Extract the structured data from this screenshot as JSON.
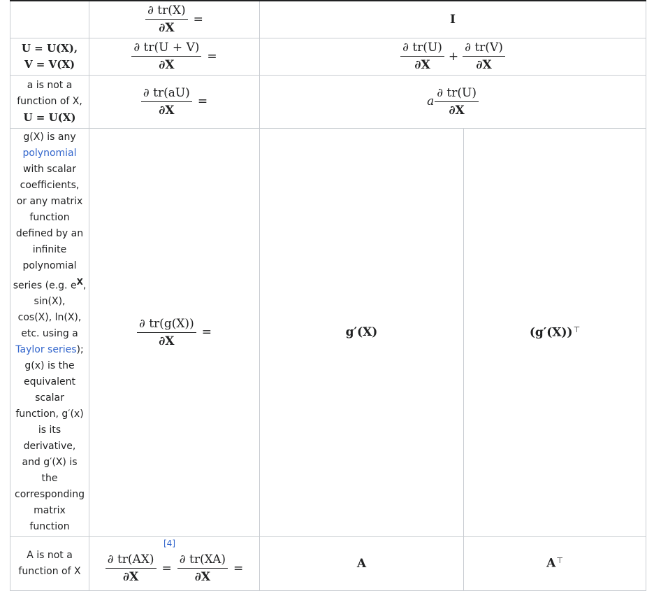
{
  "rows": {
    "r1": {
      "cond": "",
      "lhs_num": "∂ tr(X)",
      "eq": "=",
      "result": "I"
    },
    "r2": {
      "cond_line1": "U = U(X),",
      "cond_line2": "V = V(X)",
      "lhs_num": "∂ tr(U + V)",
      "lhs_den": "∂X",
      "eq": "=",
      "res_num1": "∂ tr(U)",
      "res_den1": "∂X",
      "plus": "+",
      "res_num2": "∂ tr(V)",
      "res_den2": "∂X"
    },
    "r3": {
      "cond_line1": "a is not a",
      "cond_line2": "function of X,",
      "cond_line3": "U = U(X)",
      "lhs_num": "∂ tr(aU)",
      "lhs_den": "∂X",
      "eq": "=",
      "res_coef": "a",
      "res_num": "∂ tr(U)",
      "res_den": "∂X"
    },
    "r4": {
      "cond_lines": [
        "g(X) is any",
        "polynomial",
        "with scalar",
        "coefficients,",
        "or any matrix",
        "function",
        "defined by an",
        "infinite",
        "polynomial",
        "series (e.g. e",
        "sin(X),",
        "cos(X), ln(X),",
        "etc. using a",
        "Taylor series",
        "g(x) is the",
        "equivalent",
        "scalar",
        "function, g′(x)",
        "is its",
        "derivative,",
        "and g′(X) is",
        "the",
        "corresponding",
        "matrix",
        "function"
      ],
      "exp_sup": "X",
      "after_taylor": ");",
      "lhs_num": "∂ tr(g(X))",
      "lhs_den": "∂X",
      "eq": "=",
      "result1": "g′(X)",
      "result2": "(g′(X))",
      "result2_sup": "⊤"
    },
    "r5": {
      "cond_line1": "A is not a",
      "cond_line2": "function of X",
      "ref": "[4]",
      "lhs_num1": "∂ tr(AX)",
      "lhs_den1": "∂X",
      "eq1": "=",
      "lhs_num2": "∂ tr(XA)",
      "lhs_den2": "∂X",
      "eq2": "=",
      "result1": "A",
      "result2": "A",
      "result2_sup": "⊤"
    }
  },
  "lhs_den_common": "∂X",
  "colors": {
    "link": "#3366cc",
    "border": "#c8ccd1",
    "text": "#202122"
  }
}
